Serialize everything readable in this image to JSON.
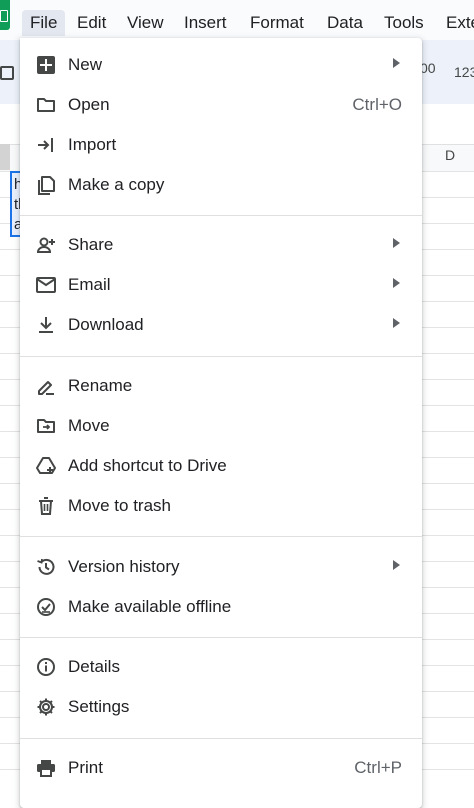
{
  "menubar": {
    "tabs": [
      "File",
      "Edit",
      "View",
      "Insert",
      "Format",
      "Data",
      "Tools",
      "Exte"
    ]
  },
  "toolbar": {
    "zero_label": "00",
    "num_format_label": "123"
  },
  "sheet": {
    "column_d": "D",
    "cell_chars": [
      "h",
      "tl",
      "a"
    ]
  },
  "file_menu": {
    "new": "New",
    "open": "Open",
    "open_shortcut": "Ctrl+O",
    "import": "Import",
    "make_copy": "Make a copy",
    "share": "Share",
    "email": "Email",
    "download": "Download",
    "rename": "Rename",
    "move": "Move",
    "add_shortcut": "Add shortcut to Drive",
    "move_trash": "Move to trash",
    "version_history": "Version history",
    "make_offline": "Make available offline",
    "details": "Details",
    "settings": "Settings",
    "print": "Print",
    "print_shortcut": "Ctrl+P"
  },
  "colors": {
    "icon": "#444746",
    "accent": "#1a73e8",
    "sheets_green": "#0f9d58"
  }
}
